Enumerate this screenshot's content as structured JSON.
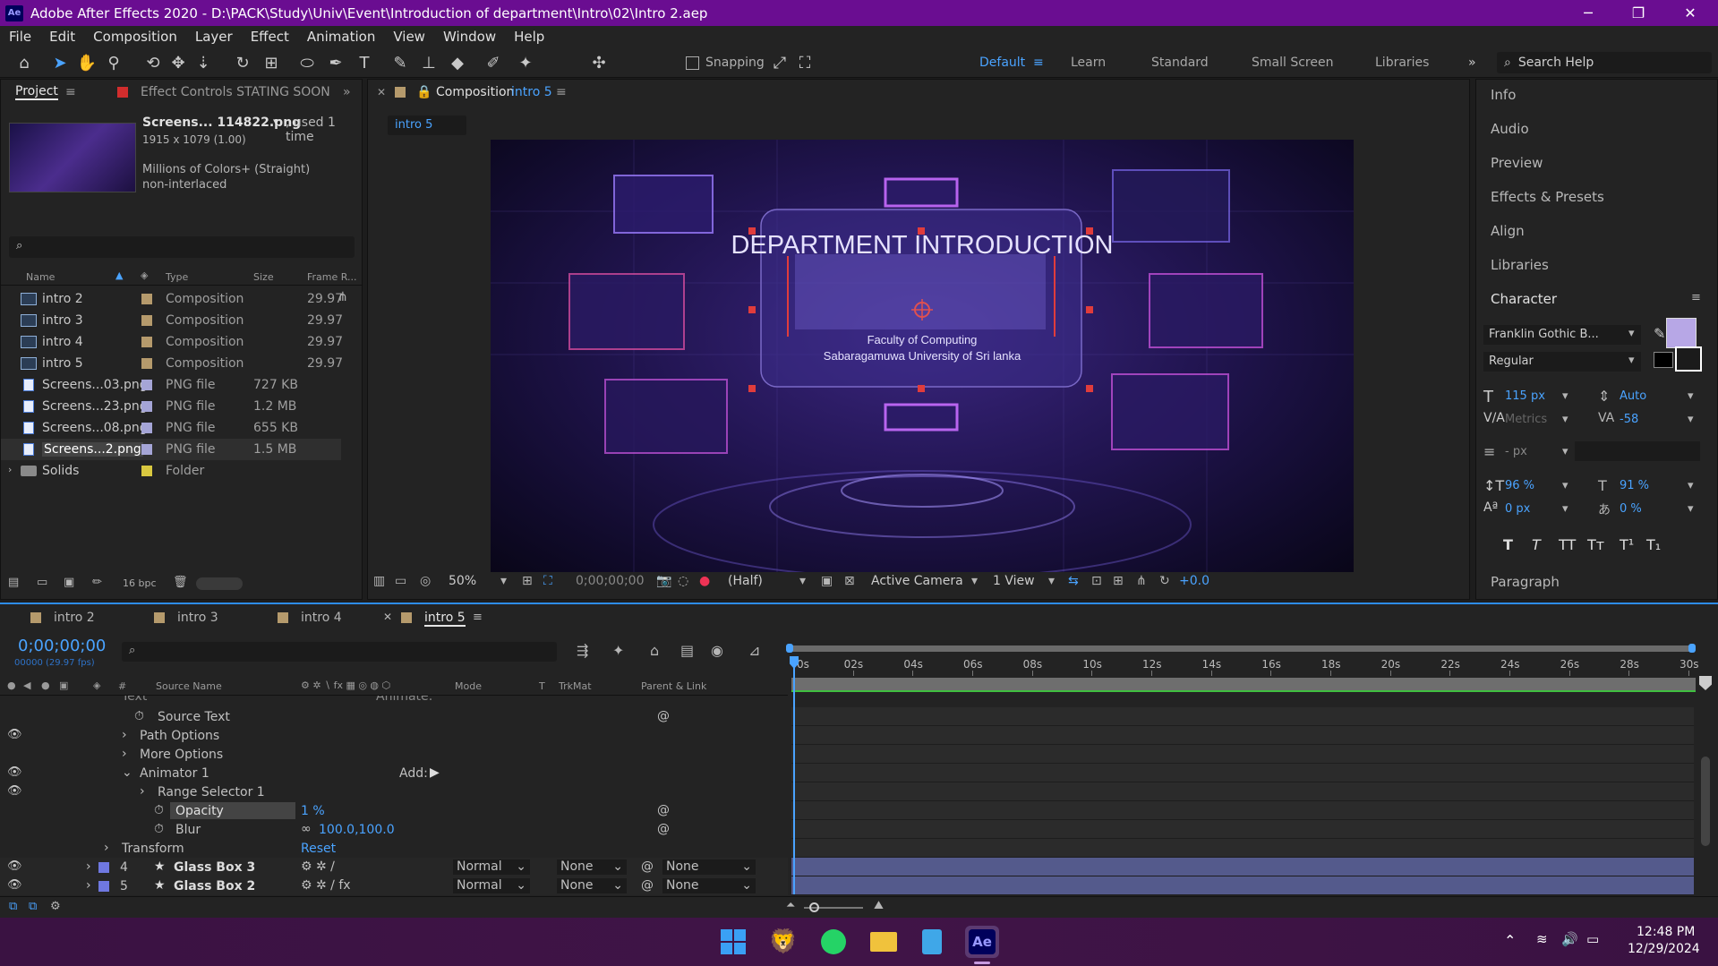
{
  "titlebar": {
    "title": "Adobe After Effects 2020 - D:\\PACK\\Study\\Univ\\Event\\Introduction of department\\Intro\\02\\Intro 2.aep",
    "logo_text": "Ae",
    "minimize": "─",
    "maximize": "❐",
    "close": "✕"
  },
  "menu": [
    "File",
    "Edit",
    "Composition",
    "Layer",
    "Effect",
    "Animation",
    "View",
    "Window",
    "Help"
  ],
  "toolbar": {
    "snapping_label": "Snapping",
    "workspaces": [
      "Default",
      "Learn",
      "Standard",
      "Small Screen",
      "Libraries"
    ],
    "active_workspace": "Default",
    "more": "»",
    "search_placeholder": "Search Help"
  },
  "project": {
    "tab_project": "Project",
    "tab_effect_controls": "Effect Controls STATING SOON",
    "preview_name": "Screens... 114822.png",
    "used": ", used 1 time",
    "dimensions": "1915 x 1079 (1.00)",
    "colors": "Millions of Colors+ (Straight)",
    "interlace": "non-interlaced",
    "columns": {
      "name": "Name",
      "type": "Type",
      "size": "Size",
      "frame_rate": "Frame R..."
    },
    "items": [
      {
        "name": "intro 2",
        "type": "Composition",
        "size": "",
        "frame_rate": "29.97",
        "label_color": "#b59a6c",
        "kind": "comp"
      },
      {
        "name": "intro 3",
        "type": "Composition",
        "size": "",
        "frame_rate": "29.97",
        "label_color": "#b59a6c",
        "kind": "comp"
      },
      {
        "name": "intro 4",
        "type": "Composition",
        "size": "",
        "frame_rate": "29.97",
        "label_color": "#b59a6c",
        "kind": "comp"
      },
      {
        "name": "intro 5",
        "type": "Composition",
        "size": "",
        "frame_rate": "29.97",
        "label_color": "#b59a6c",
        "kind": "comp"
      },
      {
        "name": "Screens...03.png",
        "type": "PNG file",
        "size": "727 KB",
        "frame_rate": "",
        "label_color": "#a5a5d6",
        "kind": "png"
      },
      {
        "name": "Screens...23.png",
        "type": "PNG file",
        "size": "1.2 MB",
        "frame_rate": "",
        "label_color": "#a5a5d6",
        "kind": "png"
      },
      {
        "name": "Screens...08.png",
        "type": "PNG file",
        "size": "655 KB",
        "frame_rate": "",
        "label_color": "#a5a5d6",
        "kind": "png"
      },
      {
        "name": "Screens...2.png",
        "type": "PNG file",
        "size": "1.5 MB",
        "frame_rate": "",
        "label_color": "#a5a5d6",
        "kind": "png"
      },
      {
        "name": "Solids",
        "type": "Folder",
        "size": "",
        "frame_rate": "",
        "label_color": "#d9c840",
        "kind": "folder"
      }
    ],
    "bpc": "16 bpc"
  },
  "composition": {
    "tab_label": "Composition",
    "comp_name": "intro 5",
    "sub_tab": "intro 5",
    "title": "DEPARTMENT INTRODUCTION",
    "subtitle_line1": "Faculty of Computing",
    "subtitle_line2": "Sabaragamuwa University of Sri lanka",
    "footer": {
      "zoom": "50%",
      "timecode": "0;00;00;00",
      "resolution": "(Half)",
      "camera": "Active Camera",
      "views": "1 View",
      "exposure": "+0.0"
    }
  },
  "right_panel": {
    "items": [
      "Info",
      "Audio",
      "Preview",
      "Effects & Presets",
      "Align",
      "Libraries"
    ],
    "character": {
      "header": "Character",
      "font": "Franklin Gothic B...",
      "style": "Regular",
      "font_size": "115 px",
      "leading": "Auto",
      "kerning": "Metrics",
      "tracking": "-58",
      "stroke": "- px",
      "vert_scale": "96 %",
      "horiz_scale": "91 %",
      "baseline": "0 px",
      "tsume": "0 %",
      "fill_color": "#b7a7e6",
      "styles": [
        "T",
        "T",
        "TT",
        "Tт",
        "T¹",
        "T₁"
      ]
    },
    "paragraph_header": "Paragraph"
  },
  "timeline": {
    "tabs": [
      "intro 2",
      "intro 3",
      "intro 4",
      "intro 5"
    ],
    "active_tab": "intro 5",
    "timecode": "0;00;00;00",
    "frame_info": "00000 (29.97 fps)",
    "columns": {
      "num": "#",
      "source": "Source Name",
      "mode": "Mode",
      "t": "T",
      "trkmat": "TrkMat",
      "parent": "Parent & Link"
    },
    "ruler": [
      "0s",
      "02s",
      "04s",
      "06s",
      "08s",
      "10s",
      "12s",
      "14s",
      "16s",
      "18s",
      "20s",
      "22s",
      "24s",
      "26s",
      "28s",
      "30s"
    ],
    "rows": {
      "text_group": "Text",
      "animate": "Animate:",
      "source_text": "Source Text",
      "path_options": "Path Options",
      "more_options": "More Options",
      "animator": "Animator 1",
      "add": "Add:",
      "range_selector": "Range Selector 1",
      "opacity_label": "Opacity",
      "opacity_value": "1 %",
      "blur_label": "Blur",
      "blur_value": "100.0,100.0",
      "transform": "Transform",
      "reset": "Reset"
    },
    "layers": [
      {
        "num": "4",
        "name": "Glass Box 3",
        "mode": "Normal",
        "trkmat": "None",
        "parent": "None"
      },
      {
        "num": "5",
        "name": "Glass Box 2",
        "mode": "Normal",
        "trkmat": "None",
        "parent": "None"
      }
    ]
  },
  "taskbar": {
    "apps": [
      "windows-start",
      "brave",
      "whatsapp",
      "file-explorer",
      "notepad",
      "after-effects"
    ],
    "ae_label": "Ae",
    "time": "12:48 PM",
    "date": "12/29/2024"
  }
}
